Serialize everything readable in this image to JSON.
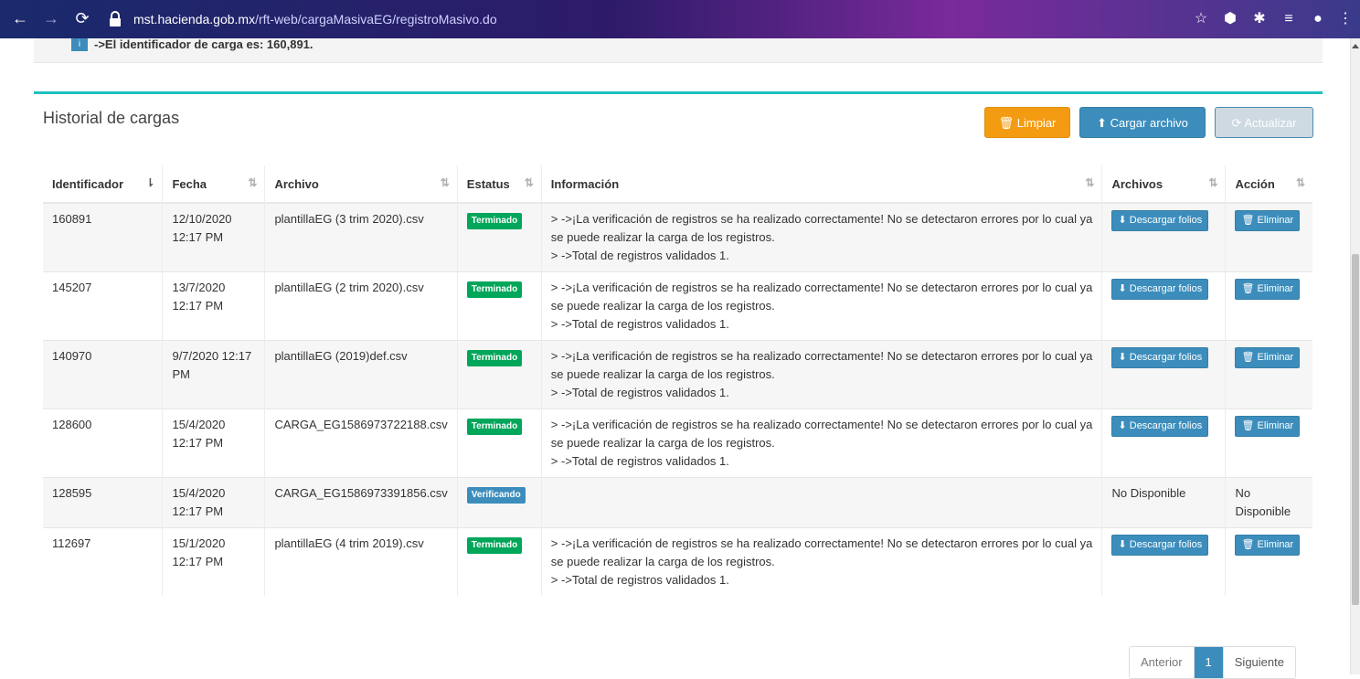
{
  "browser": {
    "url_host": "mst.hacienda.gob.mx",
    "url_path": "/rft-web/cargaMasivaEG/registroMasivo.do"
  },
  "alert": {
    "text": "->El identificador de carga es: 160,891."
  },
  "panel": {
    "title": "Historial de cargas",
    "btn_clear": "Limpiar",
    "btn_upload": "Cargar archivo",
    "btn_refresh": "Actualizar"
  },
  "table": {
    "headers": [
      "Identificador",
      "Fecha",
      "Archivo",
      "Estatus",
      "Información",
      "Archivos",
      "Acción"
    ],
    "rows": [
      {
        "id": "160891",
        "fecha": "12/10/2020 12:17 PM",
        "archivo": "plantillaEG (3 trim 2020).csv",
        "estatus": "Terminado",
        "info1": "> ->¡La verificación de registros se ha realizado correctamente! No se detectaron errores por lo cual ya se puede realizar la carga de los registros.",
        "info2": "> ->Total de registros validados 1.",
        "archivos": "Descargar folios",
        "accion": "Eliminar"
      },
      {
        "id": "145207",
        "fecha": "13/7/2020 12:17 PM",
        "archivo": "plantillaEG (2 trim 2020).csv",
        "estatus": "Terminado",
        "info1": "> ->¡La verificación de registros se ha realizado correctamente! No se detectaron errores por lo cual ya se puede realizar la carga de los registros.",
        "info2": "> ->Total de registros validados 1.",
        "archivos": "Descargar folios",
        "accion": "Eliminar"
      },
      {
        "id": "140970",
        "fecha": "9/7/2020 12:17 PM",
        "archivo": "plantillaEG (2019)def.csv",
        "estatus": "Terminado",
        "info1": "> ->¡La verificación de registros se ha realizado correctamente! No se detectaron errores por lo cual ya se puede realizar la carga de los registros.",
        "info2": "> ->Total de registros validados 1.",
        "archivos": "Descargar folios",
        "accion": "Eliminar"
      },
      {
        "id": "128600",
        "fecha": "15/4/2020 12:17 PM",
        "archivo": "CARGA_EG1586973722188.csv",
        "estatus": "Terminado",
        "info1": "> ->¡La verificación de registros se ha realizado correctamente! No se detectaron errores por lo cual ya se puede realizar la carga de los registros.",
        "info2": "> ->Total de registros validados 1.",
        "archivos": "Descargar folios",
        "accion": "Eliminar"
      },
      {
        "id": "128595",
        "fecha": "15/4/2020 12:17 PM",
        "archivo": "CARGA_EG1586973391856.csv",
        "estatus": "Verificando",
        "info1": "",
        "info2": "",
        "archivos": "No Disponible",
        "accion": "No Disponible"
      },
      {
        "id": "112697",
        "fecha": "15/1/2020 12:17 PM",
        "archivo": "plantillaEG (4 trim 2019).csv",
        "estatus": "Terminado",
        "info1": "> ->¡La verificación de registros se ha realizado correctamente! No se detectaron errores por lo cual ya se puede realizar la carga de los registros.",
        "info2": "> ->Total de registros validados 1.",
        "archivos": "Descargar folios",
        "accion": "Eliminar"
      }
    ]
  },
  "pagination": {
    "prev": "Anterior",
    "current": "1",
    "next": "Siguiente"
  },
  "colors": {
    "primary": "#3c8dbc",
    "warning": "#f39c12",
    "success": "#00a65a",
    "accent_border": "#1fc0c0"
  }
}
